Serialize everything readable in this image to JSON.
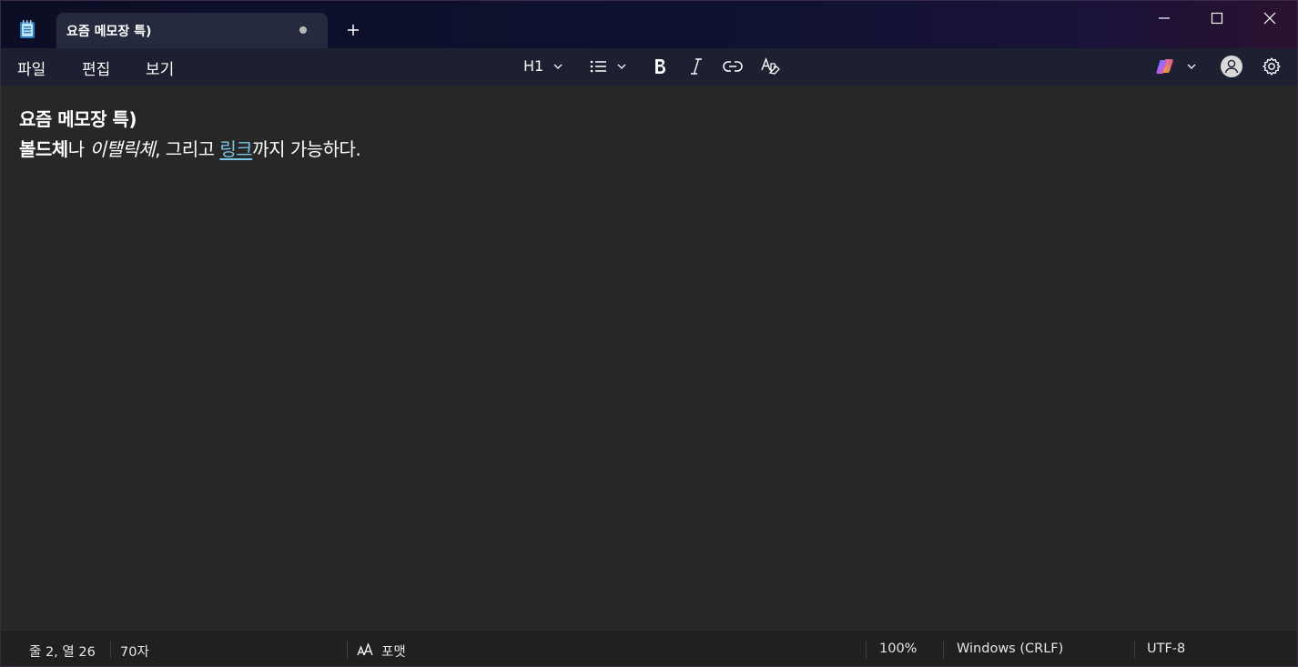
{
  "window": {
    "tab_title": "요즘 메모장 특)",
    "accent": "#79c7e8"
  },
  "menu": {
    "file": "파일",
    "edit": "편집",
    "view": "보기"
  },
  "toolbar": {
    "heading": "H1",
    "icons": [
      "list-icon",
      "bold-icon",
      "italic-icon",
      "link-icon",
      "clear-format-icon",
      "copilot-icon",
      "account-icon",
      "gear-icon"
    ]
  },
  "document": {
    "line1": "요즘 메모장 특)",
    "line2": {
      "bold": "볼드체",
      "t1": "나 ",
      "italic": "이탤릭체",
      "t2": ", 그리고 ",
      "link": "링크",
      "t3": "까지 가능하다."
    }
  },
  "status": {
    "position": "줄 2, 열 26",
    "chars": "70자",
    "format": "포맷",
    "zoom": "100%",
    "line_ending": "Windows (CRLF)",
    "encoding": "UTF-8"
  }
}
